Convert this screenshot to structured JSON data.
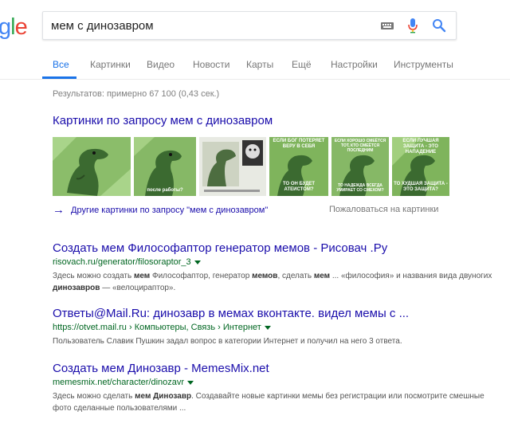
{
  "logo": {
    "letters": [
      "g",
      "l",
      "e"
    ],
    "colors": [
      "#4285f4",
      "#34a853",
      "#ea4335"
    ]
  },
  "search": {
    "value": "мем с динозавром"
  },
  "tabs": [
    {
      "label": "Все",
      "active": true
    },
    {
      "label": "Картинки"
    },
    {
      "label": "Видео"
    },
    {
      "label": "Новости"
    },
    {
      "label": "Карты"
    },
    {
      "label": "Ещё"
    },
    {
      "label": "Настройки"
    },
    {
      "label": "Инструменты"
    }
  ],
  "stats": "Результатов: примерно 67 100 (0,43 сек.)",
  "images": {
    "heading": "Картинки по запросу мем с динозавром",
    "more_link": "Другие картинки по запросу \"мем с динозавром\"",
    "report": "Пожаловаться на картинки",
    "thumbs": [
      {
        "caption_top": "",
        "caption_bottom": ""
      },
      {
        "caption_top": "",
        "caption_bottom": "после работы?"
      },
      {
        "caption_top": "",
        "caption_bottom": ""
      },
      {
        "caption_top": "ЕСЛИ БОГ ПОТЕРЯЕТ ВЕРУ В СЕБЯ",
        "caption_bottom": "ТО ОН БУДЕТ АТЕИСТОМ?"
      },
      {
        "caption_top": "ЕСЛИ ХОРОШО СМЕЁТСЯ ТОТ, КТО СМЕЁТСЯ ПОСЛЕДНИМ",
        "caption_bottom": "ТО НАДЕЖДА ВСЕГДА УМИРАЕТ СО СМЕХОМ?"
      },
      {
        "caption_top": "ЕСЛИ ЛУЧШАЯ ЗАЩИТА - ЭТО НАПАДЕНИЕ",
        "caption_bottom": "ТО ХУДШАЯ ЗАЩИТА - ЭТО ЗАЩИТА?"
      }
    ]
  },
  "results": [
    {
      "title": "Создать мем Философаптор генератор мемов - Рисовач .Ру",
      "url": "risovach.ru/generator/filosoraptor_3",
      "snippet_html": "Здесь можно создать <b>мем</b> Философаптор, генератор <b>мемов</b>, сделать <b>мем</b> ... «философия» и названия вида двуногих <b>динозавров</b> — «велоцираптор»."
    },
    {
      "title": "Ответы@Mail.Ru: динозавр в мемах вконтакте. видел мемы с ...",
      "url": "https://otvet.mail.ru › Компьютеры, Связь › Интернет",
      "snippet_html": "Пользователь Славик Пушкин задал вопрос в категории Интернет и получил на него 3 ответа."
    },
    {
      "title": "Создать мем Динозавр - MemesMix.net",
      "url": "memesmix.net/character/dinozavr",
      "snippet_html": "Здесь можно сделать <b>мем Динозавр</b>. Создавайте новые картинки мемы без регистрации или посмотрите смешные фото сделанные пользователями ..."
    }
  ]
}
